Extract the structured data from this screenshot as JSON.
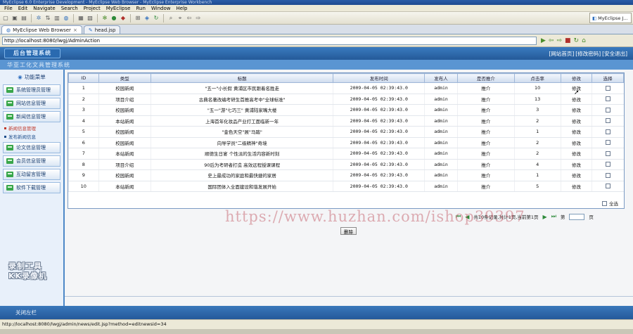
{
  "window": {
    "title": "MyEclipse 6.0 Enterprise Development - MyEclipse Web Browser - MyEclipse Enterprise Workbench"
  },
  "menu": [
    "File",
    "Edit",
    "Navigate",
    "Search",
    "Project",
    "MyEclipse",
    "Run",
    "Window",
    "Help"
  ],
  "perspective": {
    "label": "MyEclipse J..."
  },
  "editor_tabs": [
    {
      "label": "MyEclipse Web Browser",
      "active": true
    },
    {
      "label": "head.jsp",
      "active": false
    }
  ],
  "address": {
    "url": "http://localhost:8080/lwgj/AdminAction"
  },
  "app": {
    "badge": "后台管理系统",
    "subtitle": "华亚工化文具管理系统",
    "top_links": [
      "[网站首页]",
      "[修改密码]",
      "[安全退出]"
    ]
  },
  "sidebar": {
    "head": "功能菜单",
    "items": [
      {
        "label": "系统管理员管理"
      },
      {
        "label": "网站信息管理"
      },
      {
        "label": "新闻信息管理"
      }
    ],
    "subitems": [
      {
        "label": "新闻信息管理",
        "active": true
      },
      {
        "label": "发布新闻信息",
        "active": false
      }
    ],
    "items_after": [
      {
        "label": "论文信息管理"
      },
      {
        "label": "会员信息管理"
      },
      {
        "label": "互动留言管理"
      },
      {
        "label": "软件下载管理"
      }
    ],
    "watermark_lines": [
      "录制工具",
      "KK录像机"
    ]
  },
  "table": {
    "headers": [
      "ID",
      "类型",
      "标题",
      "发布时间",
      "发布人",
      "是否推介",
      "点击率",
      "修改",
      "选择"
    ],
    "rows": [
      [
        "1",
        "校园新闻",
        "\"五一\"小长假 黄浦区市民跟着名胜走",
        "2009-04-05 02:39:43.0",
        "admin",
        "推介",
        "10",
        "修改"
      ],
      [
        "2",
        "项目介绍",
        "古典名著改编考研生首推高考中\"全球标准\"",
        "2009-04-05 02:39:43.0",
        "admin",
        "推介",
        "13",
        "修改"
      ],
      [
        "3",
        "校园新闻",
        "\"五一\"游\"七巧三\" 黄浦陆家嘴大楼",
        "2009-04-05 02:39:43.0",
        "admin",
        "推介",
        "3",
        "修改"
      ],
      [
        "4",
        "本站新闻",
        "上海首年化妆品产业打工面临新一年",
        "2009-04-05 02:39:43.0",
        "admin",
        "推介",
        "2",
        "修改"
      ],
      [
        "5",
        "校园新闻",
        "\"金色天空\"展\"马踏\"",
        "2009-04-05 02:39:43.0",
        "admin",
        "推介",
        "1",
        "修改"
      ],
      [
        "6",
        "校园新闻",
        "向导学员\"二级精神\"奇境",
        "2009-04-05 02:39:43.0",
        "admin",
        "推介",
        "2",
        "修改"
      ],
      [
        "7",
        "本站新闻",
        "顺德生日宴 个性派的生活内容新时刻",
        "2009-04-05 02:39:43.0",
        "admin",
        "推介",
        "2",
        "修改"
      ],
      [
        "8",
        "项目介绍",
        "90后为考研者打造 高效远程授课课程",
        "2009-04-05 02:39:43.0",
        "admin",
        "推介",
        "4",
        "修改"
      ],
      [
        "9",
        "校园新闻",
        "史上最成功的家庭和最快捷的家居",
        "2009-04-05 02:39:43.0",
        "admin",
        "推介",
        "1",
        "修改"
      ],
      [
        "10",
        "本站新闻",
        "国际团体入全面建设和谐发展开始",
        "2009-04-05 02:39:43.0",
        "admin",
        "推介",
        "5",
        "修改"
      ]
    ],
    "select_all": "全选"
  },
  "pager": {
    "info": "共10条记录,共计1页,当前第1页",
    "goto_prefix": "第",
    "goto_suffix": "页",
    "goto_value": ""
  },
  "delete_button": "删除",
  "watermark": "https://www.huzhan.com/ishop39397",
  "footer": {
    "label": "关闭左栏"
  },
  "status": {
    "url": "http://localhost:8080/lwgj/admin/news/edit.jsp?method=editnewsid=34"
  }
}
